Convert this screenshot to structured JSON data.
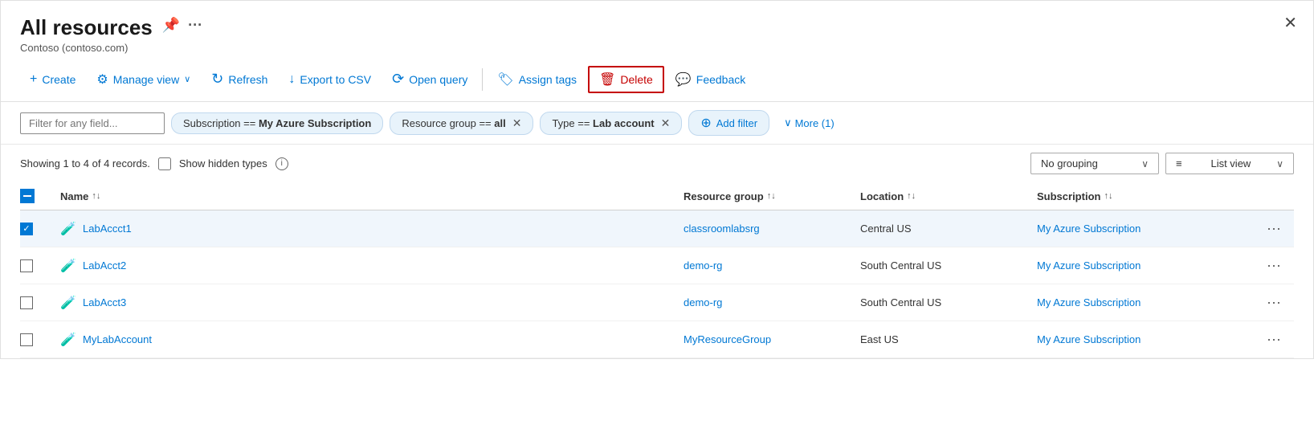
{
  "header": {
    "title": "All resources",
    "subtitle": "Contoso (contoso.com)"
  },
  "toolbar": {
    "create": "Create",
    "manage_view": "Manage view",
    "refresh": "Refresh",
    "export_csv": "Export to CSV",
    "open_query": "Open query",
    "assign_tags": "Assign tags",
    "delete": "Delete",
    "feedback": "Feedback"
  },
  "filters": {
    "placeholder": "Filter for any field...",
    "tags": [
      {
        "label": "Subscription == ",
        "bold": "My Azure Subscription",
        "closeable": false
      },
      {
        "label": "Resource group == ",
        "bold": "all",
        "closeable": true
      },
      {
        "label": "Type == ",
        "bold": "Lab account",
        "closeable": true
      }
    ],
    "add_filter": "Add filter",
    "more": "More (1)"
  },
  "list_info": {
    "showing": "Showing 1 to 4 of 4 records.",
    "show_hidden": "Show hidden types"
  },
  "grouping": {
    "label": "No grouping",
    "view": "List view"
  },
  "table": {
    "headers": [
      {
        "label": "Name",
        "sortable": true
      },
      {
        "label": "Resource group",
        "sortable": true
      },
      {
        "label": "Location",
        "sortable": true
      },
      {
        "label": "Subscription",
        "sortable": true
      }
    ],
    "rows": [
      {
        "name": "LabAccct1",
        "resource_group": "classroomlabsrg",
        "location": "Central US",
        "subscription": "My Azure Subscription",
        "selected": true
      },
      {
        "name": "LabAcct2",
        "resource_group": "demo-rg",
        "location": "South Central US",
        "subscription": "My Azure Subscription",
        "selected": false
      },
      {
        "name": "LabAcct3",
        "resource_group": "demo-rg",
        "location": "South Central US",
        "subscription": "My Azure Subscription",
        "selected": false
      },
      {
        "name": "MyLabAccount",
        "resource_group": "MyResourceGroup",
        "location": "East US",
        "subscription": "My Azure Subscription",
        "selected": false
      }
    ]
  },
  "icons": {
    "pin": "📌",
    "more_options": "···",
    "close": "✕",
    "create": "+",
    "gear": "⚙",
    "refresh": "↻",
    "export": "↓",
    "query": "⟳",
    "tags": "🏷",
    "delete": "🗑",
    "feedback": "💬",
    "chevron_down": "∨",
    "add_filter": "⊕",
    "sort": "↑↓",
    "list_view": "≡",
    "resource": "🧪"
  }
}
